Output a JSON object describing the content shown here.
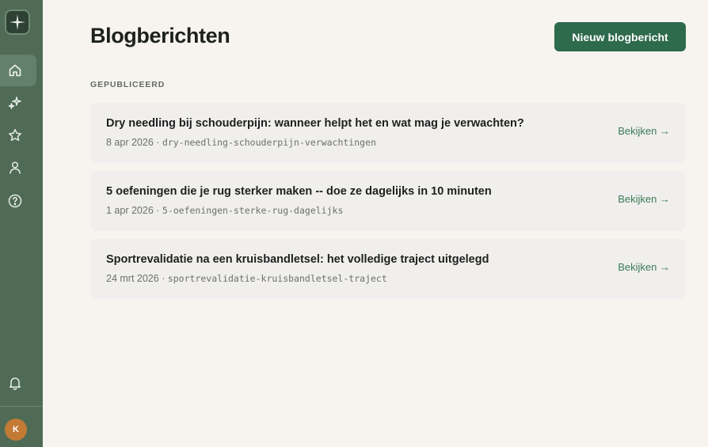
{
  "app": {
    "title": "Blogberichten",
    "new_button_label": "Nieuw blogbericht",
    "accent_color": "#2e6a4c",
    "sidebar_color": "#4f6b56"
  },
  "sidebar": {
    "logo_icon": "compass-star-icon",
    "items": [
      {
        "icon": "home-icon",
        "active": true
      },
      {
        "icon": "sparkles-icon",
        "active": false
      },
      {
        "icon": "star-icon",
        "active": false
      },
      {
        "icon": "user-icon",
        "active": false
      },
      {
        "icon": "help-circle-icon",
        "active": false
      }
    ],
    "bell_icon": "bell-icon",
    "avatar_initial": "K"
  },
  "section": {
    "label": "GEPUBLICEERD"
  },
  "posts": [
    {
      "title": "Dry needling bij schouderpijn: wanneer helpt het en wat mag je verwachten?",
      "date": "8 apr 2026",
      "separator": " · ",
      "slug": "dry-needling-schouderpijn-verwachtingen",
      "link": "Bekijken →"
    },
    {
      "title": "5 oefeningen die je rug sterker maken -- doe ze dagelijks in 10 minuten",
      "date": "1 apr 2026",
      "separator": " · ",
      "slug": "5-oefeningen-sterke-rug-dagelijks",
      "link": "Bekijken →"
    },
    {
      "title": "Sportrevalidatie na een kruisbandletsel: het volledige traject uitgelegd",
      "date": "24 mrt 2026",
      "separator": " · ",
      "slug": "sportrevalidatie-kruisbandletsel-traject",
      "link": "Bekijken →"
    }
  ]
}
